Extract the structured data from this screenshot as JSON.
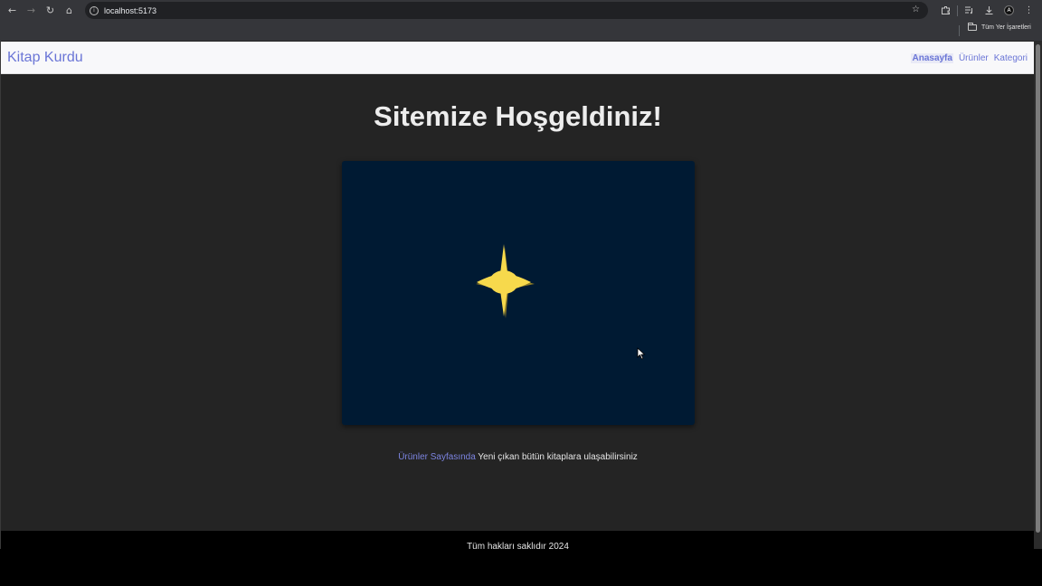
{
  "browser": {
    "url": "localhost:5173",
    "bookmarks_all_label": "Tüm Yer İşaretleri",
    "profile_initial": "A",
    "icons": {
      "back": "arrow-left-icon",
      "forward": "arrow-right-icon",
      "reload": "reload-icon",
      "home": "home-icon",
      "site_info": "info-icon",
      "bookmark": "star-icon",
      "extensions": "puzzle-icon",
      "media": "media-controls-icon",
      "downloads": "download-icon",
      "menu": "kebab-menu-icon",
      "folder": "folder-icon"
    }
  },
  "header": {
    "brand": "Kitap Kurdu",
    "nav": [
      {
        "label": "Anasayfa",
        "active": true
      },
      {
        "label": "Ürünler",
        "active": false
      },
      {
        "label": "Kategori",
        "active": false
      }
    ]
  },
  "main": {
    "title": "Sitemize Hoşgeldiniz!",
    "caption_link": "Ürünler Sayfasında",
    "caption_text": " Yeni çıkan bütün kitaplara ulaşabilirsiniz"
  },
  "footer": {
    "text": "Tüm hakları saklıdır 2024"
  },
  "colors": {
    "accent": "#6a75d6",
    "media_background": "#001a33",
    "sparkle": "#f7d94c",
    "page_background": "#242424"
  }
}
